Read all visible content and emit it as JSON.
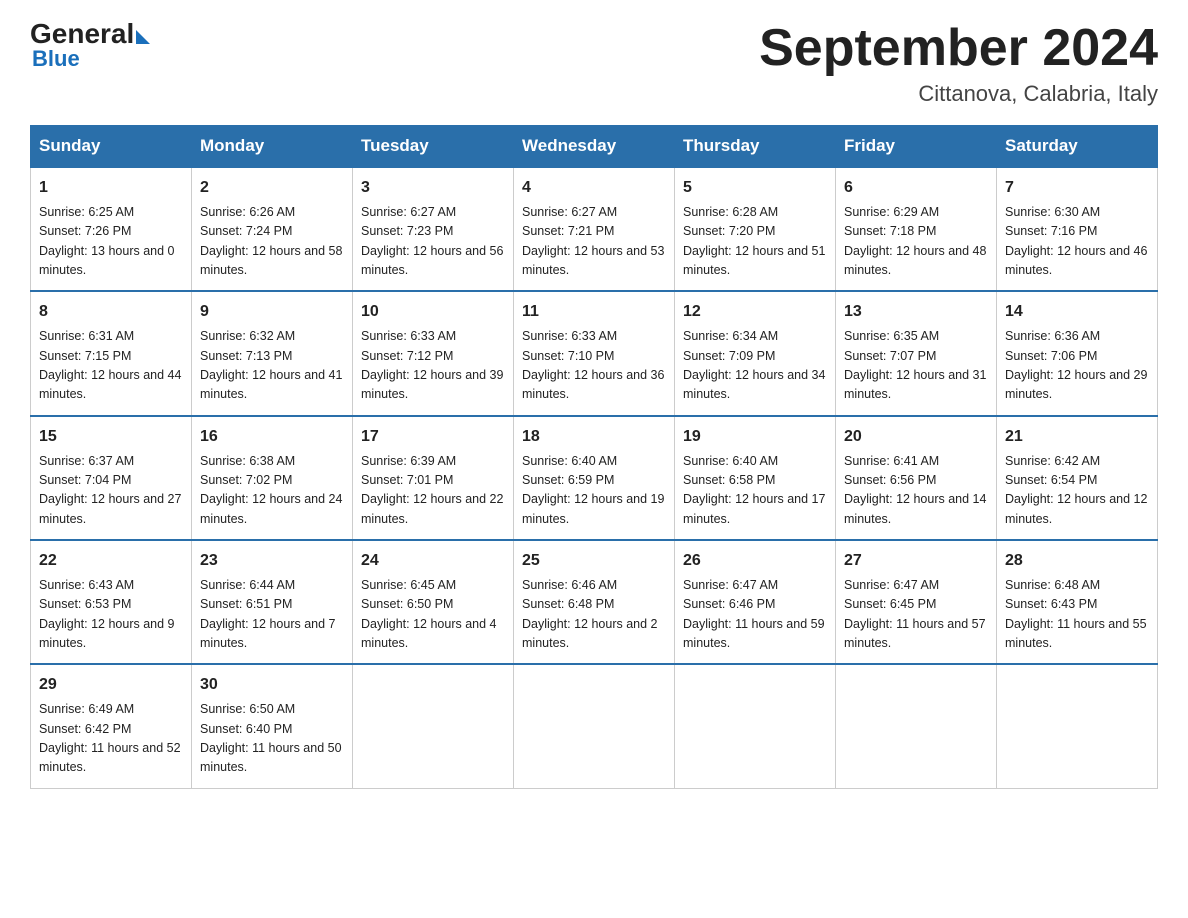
{
  "header": {
    "logo_general": "General",
    "logo_blue": "Blue",
    "month_title": "September 2024",
    "subtitle": "Cittanova, Calabria, Italy"
  },
  "days_of_week": [
    "Sunday",
    "Monday",
    "Tuesday",
    "Wednesday",
    "Thursday",
    "Friday",
    "Saturday"
  ],
  "weeks": [
    [
      {
        "day": "1",
        "sunrise": "6:25 AM",
        "sunset": "7:26 PM",
        "daylight": "13 hours and 0 minutes."
      },
      {
        "day": "2",
        "sunrise": "6:26 AM",
        "sunset": "7:24 PM",
        "daylight": "12 hours and 58 minutes."
      },
      {
        "day": "3",
        "sunrise": "6:27 AM",
        "sunset": "7:23 PM",
        "daylight": "12 hours and 56 minutes."
      },
      {
        "day": "4",
        "sunrise": "6:27 AM",
        "sunset": "7:21 PM",
        "daylight": "12 hours and 53 minutes."
      },
      {
        "day": "5",
        "sunrise": "6:28 AM",
        "sunset": "7:20 PM",
        "daylight": "12 hours and 51 minutes."
      },
      {
        "day": "6",
        "sunrise": "6:29 AM",
        "sunset": "7:18 PM",
        "daylight": "12 hours and 48 minutes."
      },
      {
        "day": "7",
        "sunrise": "6:30 AM",
        "sunset": "7:16 PM",
        "daylight": "12 hours and 46 minutes."
      }
    ],
    [
      {
        "day": "8",
        "sunrise": "6:31 AM",
        "sunset": "7:15 PM",
        "daylight": "12 hours and 44 minutes."
      },
      {
        "day": "9",
        "sunrise": "6:32 AM",
        "sunset": "7:13 PM",
        "daylight": "12 hours and 41 minutes."
      },
      {
        "day": "10",
        "sunrise": "6:33 AM",
        "sunset": "7:12 PM",
        "daylight": "12 hours and 39 minutes."
      },
      {
        "day": "11",
        "sunrise": "6:33 AM",
        "sunset": "7:10 PM",
        "daylight": "12 hours and 36 minutes."
      },
      {
        "day": "12",
        "sunrise": "6:34 AM",
        "sunset": "7:09 PM",
        "daylight": "12 hours and 34 minutes."
      },
      {
        "day": "13",
        "sunrise": "6:35 AM",
        "sunset": "7:07 PM",
        "daylight": "12 hours and 31 minutes."
      },
      {
        "day": "14",
        "sunrise": "6:36 AM",
        "sunset": "7:06 PM",
        "daylight": "12 hours and 29 minutes."
      }
    ],
    [
      {
        "day": "15",
        "sunrise": "6:37 AM",
        "sunset": "7:04 PM",
        "daylight": "12 hours and 27 minutes."
      },
      {
        "day": "16",
        "sunrise": "6:38 AM",
        "sunset": "7:02 PM",
        "daylight": "12 hours and 24 minutes."
      },
      {
        "day": "17",
        "sunrise": "6:39 AM",
        "sunset": "7:01 PM",
        "daylight": "12 hours and 22 minutes."
      },
      {
        "day": "18",
        "sunrise": "6:40 AM",
        "sunset": "6:59 PM",
        "daylight": "12 hours and 19 minutes."
      },
      {
        "day": "19",
        "sunrise": "6:40 AM",
        "sunset": "6:58 PM",
        "daylight": "12 hours and 17 minutes."
      },
      {
        "day": "20",
        "sunrise": "6:41 AM",
        "sunset": "6:56 PM",
        "daylight": "12 hours and 14 minutes."
      },
      {
        "day": "21",
        "sunrise": "6:42 AM",
        "sunset": "6:54 PM",
        "daylight": "12 hours and 12 minutes."
      }
    ],
    [
      {
        "day": "22",
        "sunrise": "6:43 AM",
        "sunset": "6:53 PM",
        "daylight": "12 hours and 9 minutes."
      },
      {
        "day": "23",
        "sunrise": "6:44 AM",
        "sunset": "6:51 PM",
        "daylight": "12 hours and 7 minutes."
      },
      {
        "day": "24",
        "sunrise": "6:45 AM",
        "sunset": "6:50 PM",
        "daylight": "12 hours and 4 minutes."
      },
      {
        "day": "25",
        "sunrise": "6:46 AM",
        "sunset": "6:48 PM",
        "daylight": "12 hours and 2 minutes."
      },
      {
        "day": "26",
        "sunrise": "6:47 AM",
        "sunset": "6:46 PM",
        "daylight": "11 hours and 59 minutes."
      },
      {
        "day": "27",
        "sunrise": "6:47 AM",
        "sunset": "6:45 PM",
        "daylight": "11 hours and 57 minutes."
      },
      {
        "day": "28",
        "sunrise": "6:48 AM",
        "sunset": "6:43 PM",
        "daylight": "11 hours and 55 minutes."
      }
    ],
    [
      {
        "day": "29",
        "sunrise": "6:49 AM",
        "sunset": "6:42 PM",
        "daylight": "11 hours and 52 minutes."
      },
      {
        "day": "30",
        "sunrise": "6:50 AM",
        "sunset": "6:40 PM",
        "daylight": "11 hours and 50 minutes."
      },
      null,
      null,
      null,
      null,
      null
    ]
  ]
}
